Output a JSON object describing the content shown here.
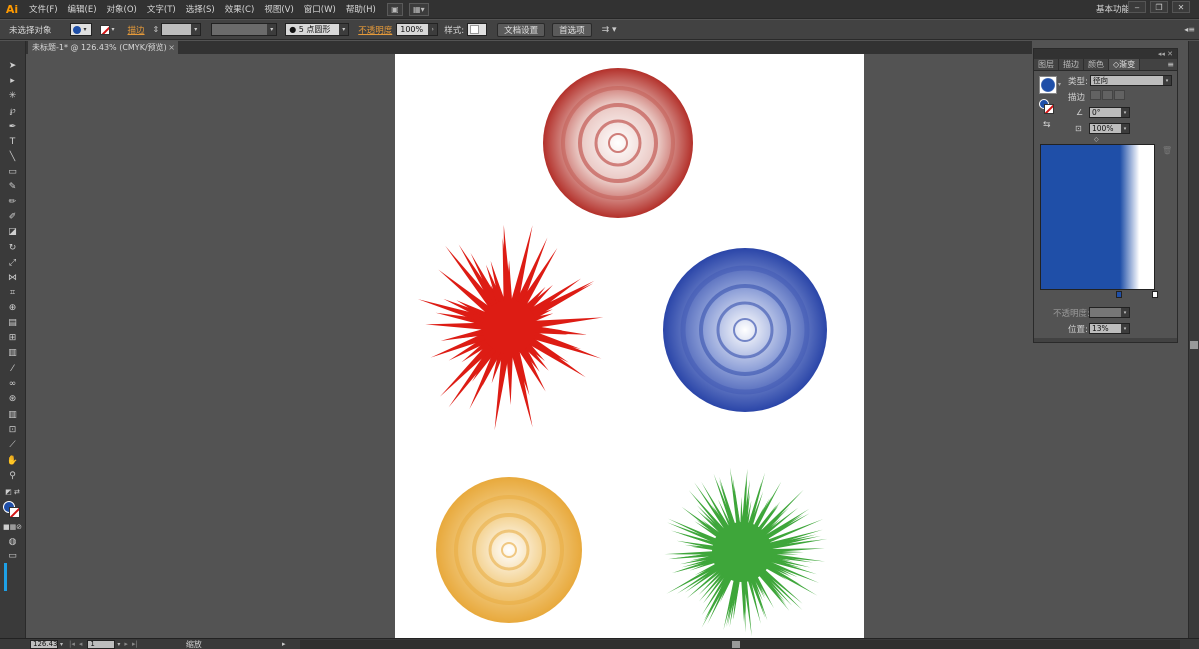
{
  "app": {
    "logo": "Ai"
  },
  "menu": [
    "文件(F)",
    "编辑(E)",
    "对象(O)",
    "文字(T)",
    "选择(S)",
    "效果(C)",
    "视图(V)",
    "窗口(W)",
    "帮助(H)"
  ],
  "workspace": "基本功能",
  "window_controls": [
    "‒",
    "❐",
    "✕"
  ],
  "control": {
    "selection_status": "未选择对象",
    "stroke_label": "描边",
    "brush_value": "● 5 点圆形",
    "opacity_label": "不透明度",
    "opacity_value": "100%",
    "style_label": "样式:",
    "doc_setup": "文档设置",
    "preferences": "首选项"
  },
  "document_tab": {
    "title": "未标题-1* @ 126.43% (CMYK/预览)",
    "close": "×"
  },
  "panel": {
    "tabs": [
      "图层",
      "描边",
      "颜色",
      "渐变"
    ],
    "active_tab": "渐变",
    "type_label": "类型:",
    "type_value": "径向",
    "stroke_label": "描边",
    "angle_value": "0°",
    "aspect_value": "100%",
    "opacity_label": "不透明度:",
    "location_label": "位置:",
    "location_value": "13%"
  },
  "colors": {
    "fill": "#1f4fa8",
    "stroke": "none",
    "gradient_start": "#1f4fa8",
    "gradient_end": "#ffffff"
  },
  "flowers": [
    {
      "name": "red-rose",
      "color": "#b3302a"
    },
    {
      "name": "red-spiky",
      "color": "#dd1c14"
    },
    {
      "name": "blue-rose",
      "color": "#2a45a8"
    },
    {
      "name": "yellow-rose",
      "color": "#e8a93c"
    },
    {
      "name": "green-spiky",
      "color": "#3ea63a"
    }
  ],
  "status": {
    "zoom": "126.43",
    "page": "1",
    "tool": "缩放"
  }
}
